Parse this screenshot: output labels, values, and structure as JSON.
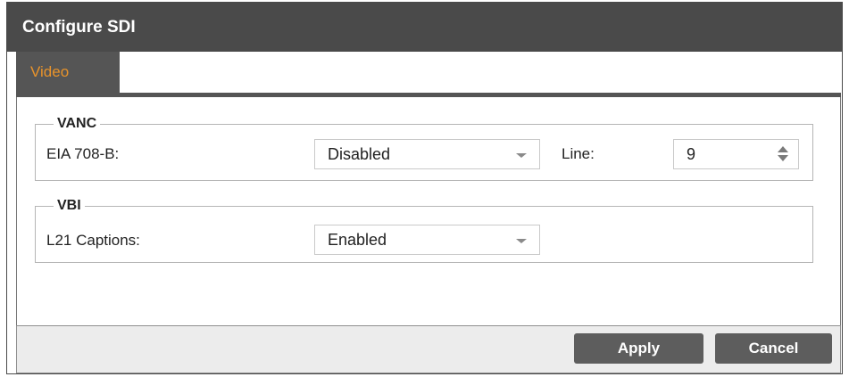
{
  "dialog": {
    "title": "Configure SDI",
    "tabs": [
      {
        "label": "Video",
        "active": true
      }
    ]
  },
  "vanc": {
    "legend": "VANC",
    "eia_label": "EIA 708-B:",
    "eia_value": "Disabled",
    "line_label": "Line:",
    "line_value": "9"
  },
  "vbi": {
    "legend": "VBI",
    "l21_label": "L21 Captions:",
    "l21_value": "Enabled"
  },
  "buttons": {
    "apply": "Apply",
    "cancel": "Cancel"
  },
  "colors": {
    "titlebar": "#4a4a4a",
    "tab_active_bg": "#555555",
    "tab_active_text": "#e8932a",
    "button_bg": "#5d5d5d"
  }
}
